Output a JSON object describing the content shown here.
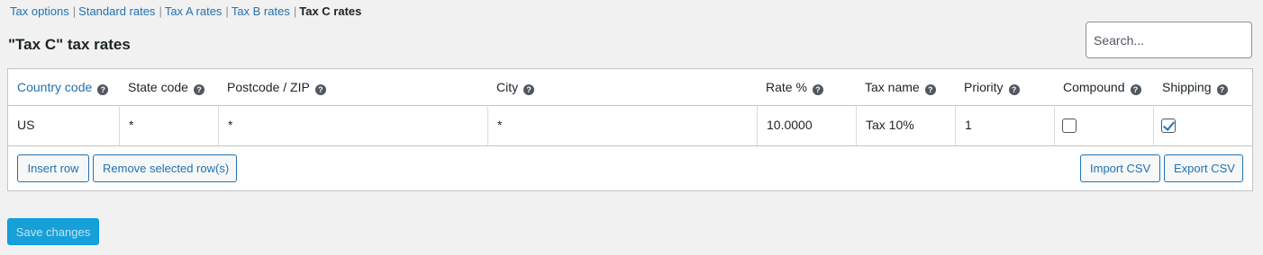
{
  "subsubsub": {
    "tax_options": "Tax options",
    "standard_rates": "Standard rates",
    "tax_a_rates": "Tax A rates",
    "tax_b_rates": "Tax B rates",
    "tax_c_rates": "Tax C rates",
    "separator": "|"
  },
  "page": {
    "title": "\"Tax C\" tax rates"
  },
  "search": {
    "placeholder": "Search..."
  },
  "table": {
    "help_glyph": "?",
    "headers": {
      "country": "Country code",
      "state": "State code",
      "postcode": "Postcode / ZIP",
      "city": "City",
      "rate": "Rate %",
      "name": "Tax name",
      "priority": "Priority",
      "compound": "Compound",
      "shipping": "Shipping"
    },
    "rows": [
      {
        "country": "US",
        "state": "*",
        "postcode": "*",
        "city": "*",
        "rate": "10.0000",
        "name": "Tax 10%",
        "priority": "1",
        "compound": false,
        "shipping": true
      }
    ]
  },
  "actions": {
    "insert_row": "Insert row",
    "remove_rows": "Remove selected row(s)",
    "import_csv": "Import CSV",
    "export_csv": "Export CSV",
    "save_changes": "Save changes"
  }
}
